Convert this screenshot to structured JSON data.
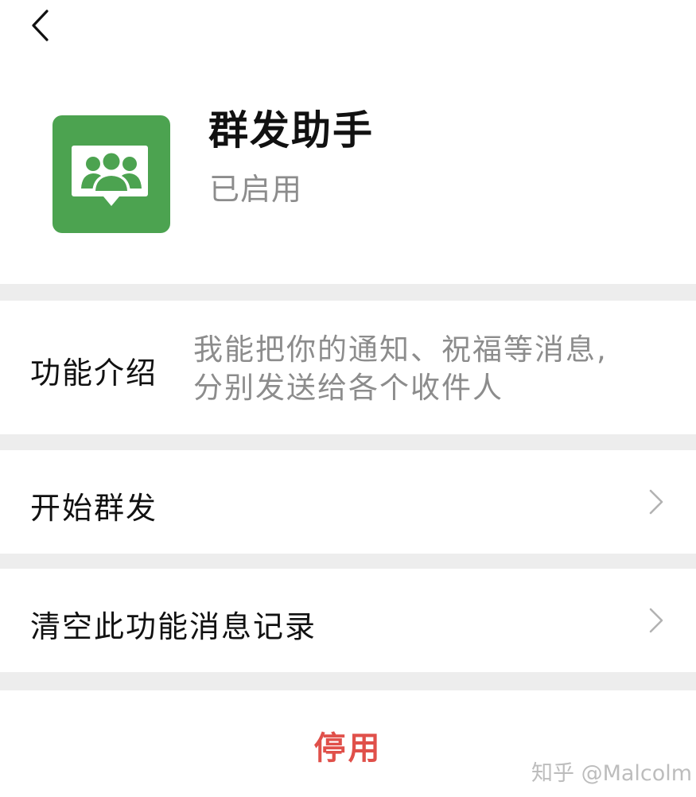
{
  "header": {
    "back_icon": "chevron-left-icon",
    "app_icon": "group-chat-icon",
    "app_icon_color": "#4ca350",
    "title": "群发助手",
    "status": "已启用"
  },
  "intro": {
    "label": "功能介绍",
    "text_line1": "我能把你的通知、祝福等消息,",
    "text_line2": "分别发送给各个收件人"
  },
  "menu": {
    "start_label": "开始群发",
    "clear_label": "清空此功能消息记录",
    "chevron_icon": "chevron-right-icon"
  },
  "footer": {
    "stop_label": "停用",
    "stop_color": "#e0504a"
  },
  "watermark": {
    "text": "知乎 @Malcolm"
  }
}
